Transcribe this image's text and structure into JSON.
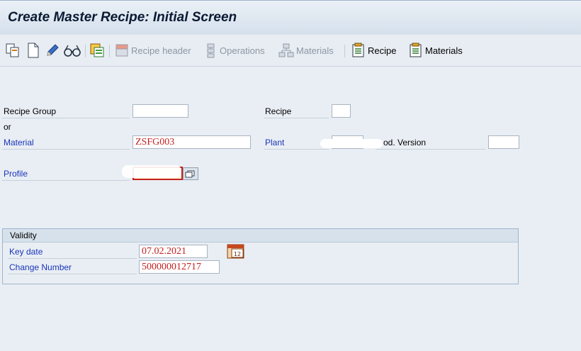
{
  "window": {
    "title": "Create Master Recipe: Initial Screen"
  },
  "toolbar": {
    "icons": [
      "copy-from-icon",
      "new-document-icon",
      "change-pencil-icon",
      "display-glasses-icon",
      "check-status-icon"
    ],
    "recipe_header_label": "Recipe header",
    "operations_label": "Operations",
    "materials_disabled_label": "Materials",
    "recipe_label": "Recipe",
    "materials_label": "Materials"
  },
  "form": {
    "recipe_group_label": "Recipe Group",
    "recipe_group_value": "",
    "recipe_label": "Recipe",
    "recipe_value": "",
    "or_label": "or",
    "material_label": "Material",
    "material_value": "ZSFG003",
    "plant_label": "Plant",
    "plant_value": "",
    "prod_version_label": "od. Version",
    "prod_version_value": "",
    "profile_label": "Profile",
    "profile_value": ""
  },
  "validity": {
    "title": "Validity",
    "key_date_label": "Key date",
    "key_date_value": "07.02.2021",
    "change_number_label": "Change Number",
    "change_number_value": "500000012717"
  },
  "colors": {
    "accent_blue": "#1a35b8",
    "value_red": "#c41f1f",
    "background": "#e9eef4"
  }
}
